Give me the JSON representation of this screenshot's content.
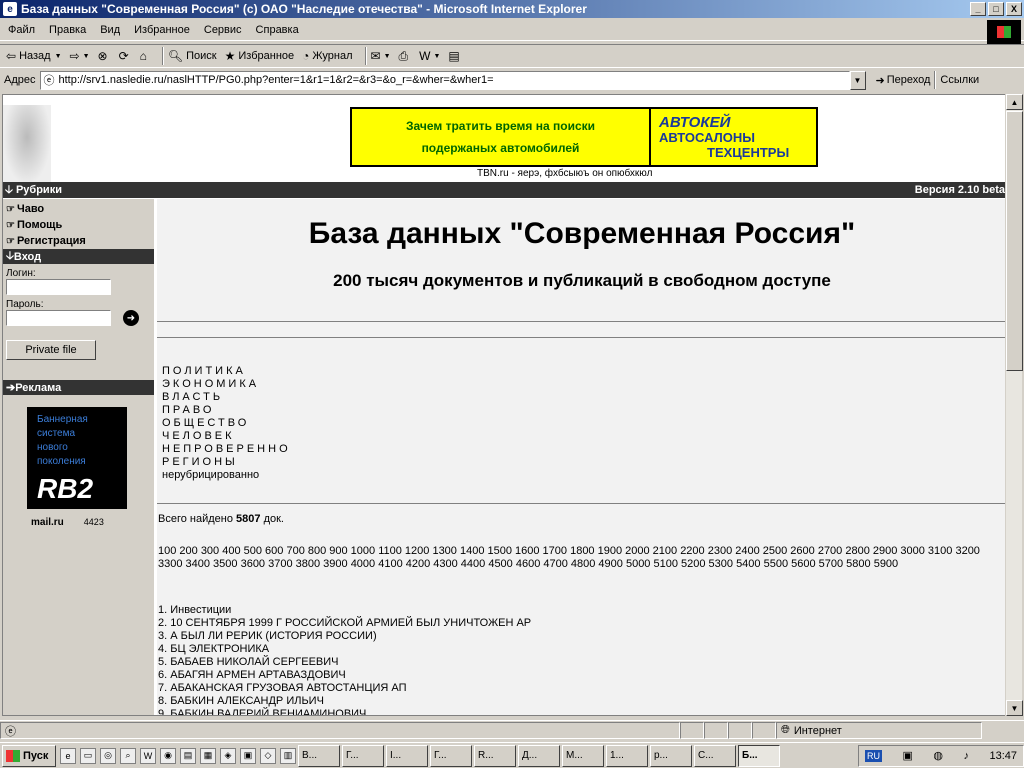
{
  "window": {
    "title": "База данных \"Современная Россия\" (с) ОАО \"Наследие отечества\" - Microsoft Internet Explorer",
    "controls": [
      "_",
      "□",
      "X"
    ]
  },
  "menu": [
    "Файл",
    "Правка",
    "Вид",
    "Избранное",
    "Сервис",
    "Справка"
  ],
  "toolbar": {
    "back": "Назад",
    "search": "Поиск",
    "favorites": "Избранное",
    "history": "Журнал"
  },
  "address": {
    "label": "Адрес",
    "url": "http://srv1.nasledie.ru/naslHTTP/PG0.php?enter=1&r1=1&r2=&r3=&o_r=&wher=&wher1=",
    "go": "Переход",
    "links": "Ссылки"
  },
  "page": {
    "banner": {
      "line1": "Зачем тратить время на поиски",
      "line2": "подержаных автомобилей",
      "brand": "АВТОКЕЙ",
      "sub1": "АВТОСАЛОНЫ",
      "sub2": "ТЕХЦЕНТРЫ",
      "caption": "TBN.ru - яерэ, фхбсыюъ он опюбхкюл"
    },
    "rubrics": "Рубрики",
    "version": "Версия 2.10 beta",
    "sidebar": {
      "links": [
        "Чаво",
        "Помощь",
        "Регистрация"
      ],
      "login_header": "Вход",
      "login_label": "Логин:",
      "password_label": "Пароль:",
      "private_file": "Private file",
      "ads_header": "Реклама",
      "ad_text": [
        "Баннерная",
        "система",
        "нового",
        "поколения"
      ],
      "ad_logo": "RB2",
      "mail": "mail.ru",
      "counter": "4423"
    },
    "title": "База данных \"Современная Россия\"",
    "subtitle": "200 тысяч документов и публикаций в свободном доступе",
    "categories": [
      "ПОЛИТИКА",
      "ЭКОНОМИКА",
      "ВЛАСТЬ",
      "ПРАВО",
      "ОБЩЕСТВО",
      "ЧЕЛОВЕК",
      "НЕПРОВЕРЕННО",
      "РЕГИОНЫ"
    ],
    "uncategorized": "нерубрицированно",
    "found_prefix": "Всего найдено",
    "found_count": "5807",
    "found_suffix": "док.",
    "pages": "100 200 300 400 500 600 700 800 900 1000 1100 1200 1300 1400 1500 1600 1700 1800 1900 2000 2100 2200 2300 2400 2500 2600 2700 2800 2900 3000 3100 3200 3300 3400 3500 3600 3700 3800 3900 4000 4100 4200 4300 4400 4500 4600 4700 4800 4900 5000 5100 5200 5300 5400 5500 5600 5700 5800 5900",
    "results": [
      "1. Инвестиции",
      "2. 10 СЕНТЯБРЯ 1999 Г РОССИЙСКОЙ АРМИЕЙ БЫЛ УНИЧТОЖЕН АР",
      "3. А БЫЛ ЛИ РЕРИК (ИСТОРИЯ РОССИИ)",
      "4. БЦ ЭЛЕКТРОНИКА",
      "5. БАБАЕВ НИКОЛАЙ СЕРГЕЕВИЧ",
      "6. АБАГЯН АРМЕН АРТАВАЗДОВИЧ",
      "7. АБАКАНСКАЯ ГРУЗОВАЯ АВТОСТАНЦИЯ АП",
      "8. БАБКИН АЛЕКСАНДР ИЛЬИЧ",
      "9. БАБКИН ВАЛЕРИЙ ВЕНИАМИНОВИЧ"
    ]
  },
  "status": {
    "zone": "Интернет"
  },
  "taskbar": {
    "start": "Пуск",
    "tasks": [
      "В...",
      "Г...",
      "I...",
      "Г...",
      "R...",
      "Д...",
      "М...",
      "1...",
      "р...",
      "С...",
      "Б..."
    ],
    "lang": "RU",
    "clock": "13:47"
  }
}
